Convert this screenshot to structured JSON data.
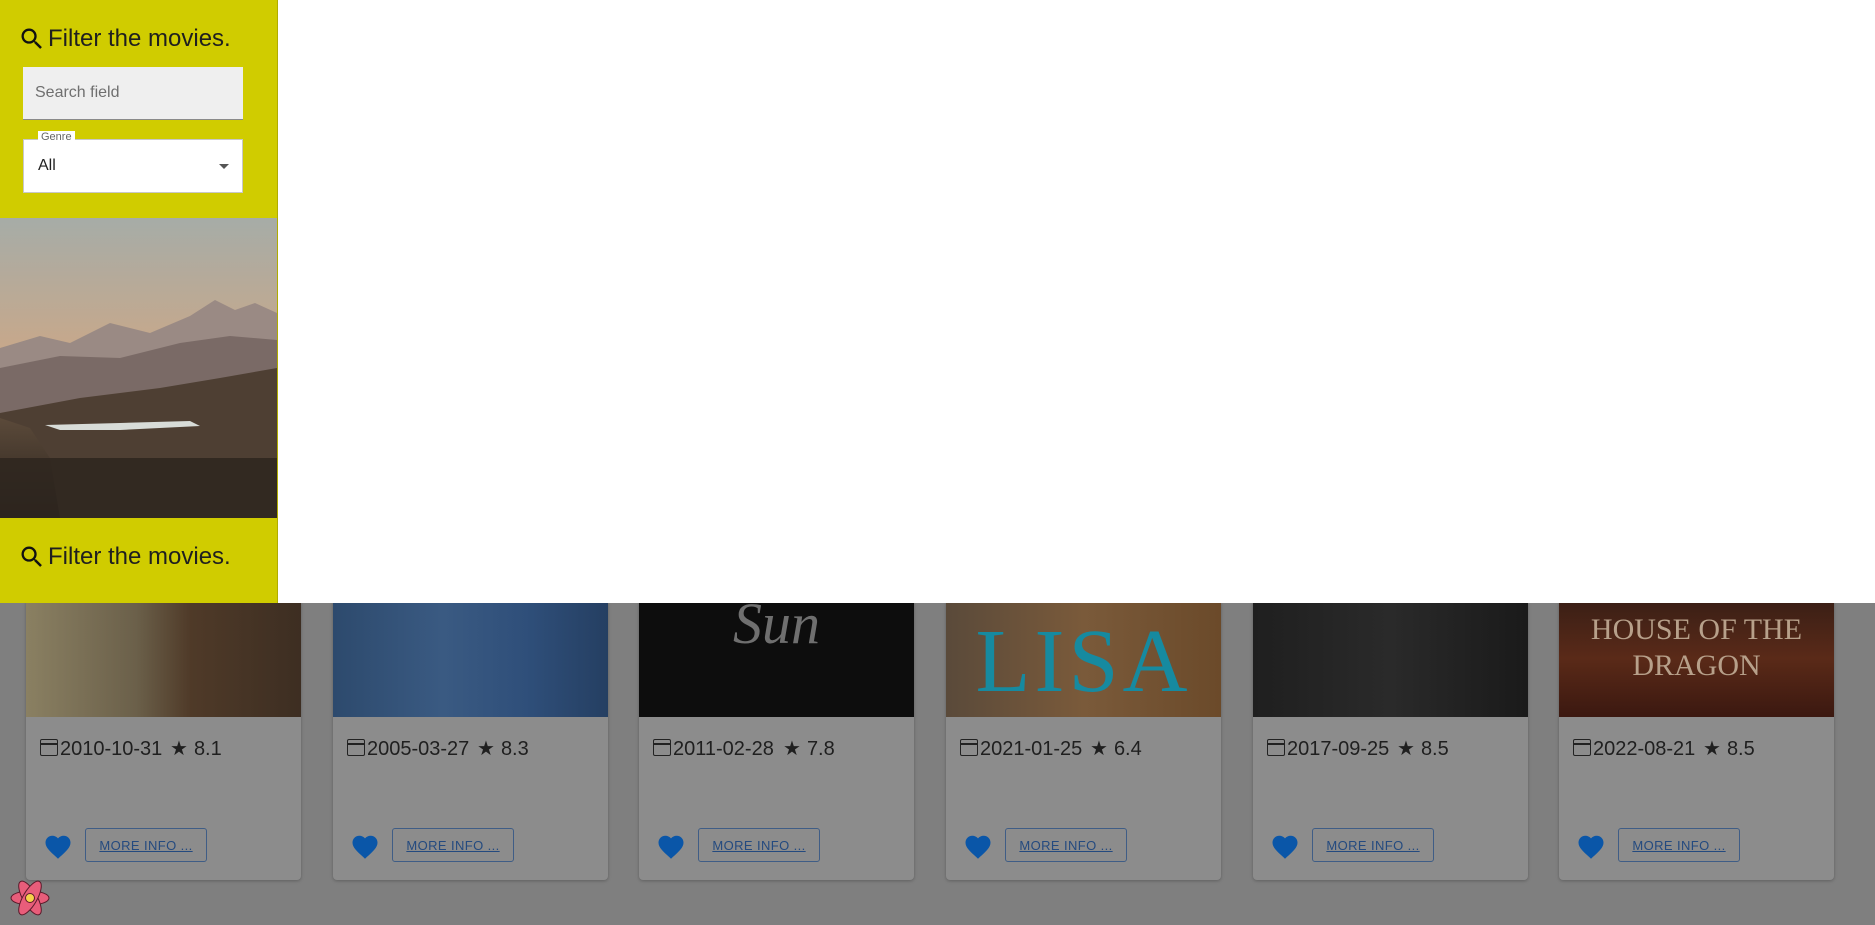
{
  "sidebar": {
    "filter_title": "Filter the movies.",
    "search_placeholder": "Search field",
    "genre_label": "Genre",
    "genre_value": "All",
    "filter_title_bottom": "Filter the movies."
  },
  "movies": [
    {
      "date": "2010-10-31",
      "rating": "8.1",
      "more": "MORE INFO ...",
      "poster_text": ""
    },
    {
      "date": "2005-03-27",
      "rating": "8.3",
      "more": "MORE INFO ...",
      "poster_text": ""
    },
    {
      "date": "2011-02-28",
      "rating": "7.8",
      "more": "MORE INFO ...",
      "poster_text": "Sun"
    },
    {
      "date": "2021-01-25",
      "rating": "6.4",
      "more": "MORE INFO ...",
      "poster_text": "LISA"
    },
    {
      "date": "2017-09-25",
      "rating": "8.5",
      "more": "MORE INFO ...",
      "poster_text": ""
    },
    {
      "date": "2022-08-21",
      "rating": "8.5",
      "more": "MORE INFO ...",
      "poster_text": "HOUSE OF THE DRAGON"
    }
  ],
  "colors": {
    "sidebar_bg": "#d0cc00",
    "heart": "#0a56a8",
    "button_text": "#244a7f",
    "overlay": "#7f7f7f"
  },
  "icons": [
    "search-icon",
    "calendar-icon",
    "star-icon",
    "heart-icon",
    "chevron-down-icon",
    "react-logo-icon"
  ]
}
